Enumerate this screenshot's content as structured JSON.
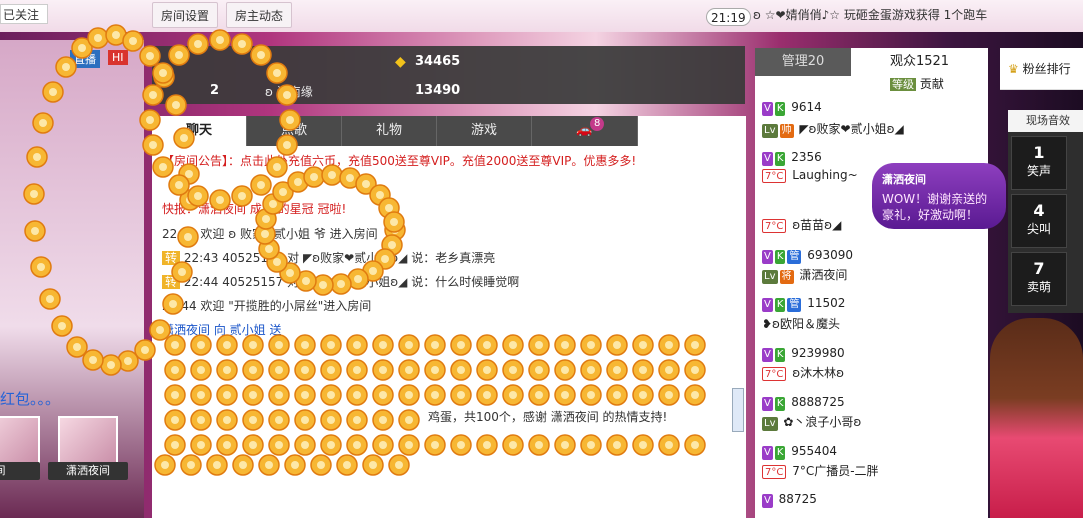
{
  "topbar": {
    "follow_label": "已关注",
    "room_settings": "房间设置",
    "host_news": "房主动态",
    "clock": "21:19",
    "ticker": "ʚ ☆❤婧俏俏♪☆ 玩砸金蛋游戏获得 1个跑车"
  },
  "left": {
    "stream_tag": "直播",
    "hd_tag": "HI",
    "hongbao_text": "红包。。。",
    "thumb_left_name": "间",
    "thumb_right_name": "潇洒夜间"
  },
  "stats": {
    "coins": "34465",
    "second_value": "13490",
    "rank": "2",
    "rank_name": "ʚ 江南缘"
  },
  "chat_tabs": [
    "聊天",
    "点歌",
    "礼物",
    "游戏",
    ""
  ],
  "chat_badge": "8",
  "messages": [
    {
      "text": "【房间公告】：点击此处充值六币，充值500送至尊VIP。充值2000送至尊VIP。优惠多多!"
    },
    {
      "text": "快报：潇洒夜间 成为 的星冠 冠啦!"
    },
    {
      "text": "22:43 欢迎 ʚ 败家❤贰小姐 爷 进入房间"
    },
    {
      "text": "22:43 40525157 对 ◤ʚ败家❤贰小姐ʚ◢ 说：老乡真漂亮"
    },
    {
      "text": "22:44 40525157 对 ◤ʚ败家❤贰小姐ʚ◢ 说：什么时候睡觉啊"
    },
    {
      "text": "22:44 欢迎 \"开揽胜的小屌丝\"进入房间"
    },
    {
      "text": "潇洒夜间 向 贰小姐 送"
    },
    {
      "text": "鸡蛋，共100个，感谢 潇洒夜间 的热情支持!"
    }
  ],
  "right": {
    "tab_manage": "管理20",
    "tab_audience": "观众1521",
    "contrib_level": "等级",
    "contrib_label": "贡献",
    "users": [
      {
        "name": "9614"
      },
      {
        "name": "◤ʚ败家❤贰小姐ʚ◢"
      },
      {
        "name": "2356"
      },
      {
        "name": "Laughing~"
      },
      {
        "name": "ʚ苗苗ʚ◢"
      },
      {
        "name": "693090"
      },
      {
        "name": "潇洒夜间"
      },
      {
        "name": "11502"
      },
      {
        "name": "❥ʚ欧阳＆魔头"
      },
      {
        "name": "9239980"
      },
      {
        "name": "ʚ沐木林ʚ"
      },
      {
        "name": "8888725"
      },
      {
        "name": "✿丶浪子小哥ʚ"
      },
      {
        "name": "955404"
      },
      {
        "name": "7°C广播员-二胖"
      },
      {
        "name": "88725"
      }
    ]
  },
  "fans_label": "粉丝排行",
  "sound": {
    "header": "现场音效",
    "buttons": [
      {
        "num": "1",
        "label": "笑声"
      },
      {
        "num": "4",
        "label": "尖叫"
      },
      {
        "num": "7",
        "label": "卖萌"
      }
    ]
  },
  "bubble": {
    "title": "潇洒夜间",
    "text": "WOW！谢谢亲送的豪礼，好激动啊！"
  }
}
